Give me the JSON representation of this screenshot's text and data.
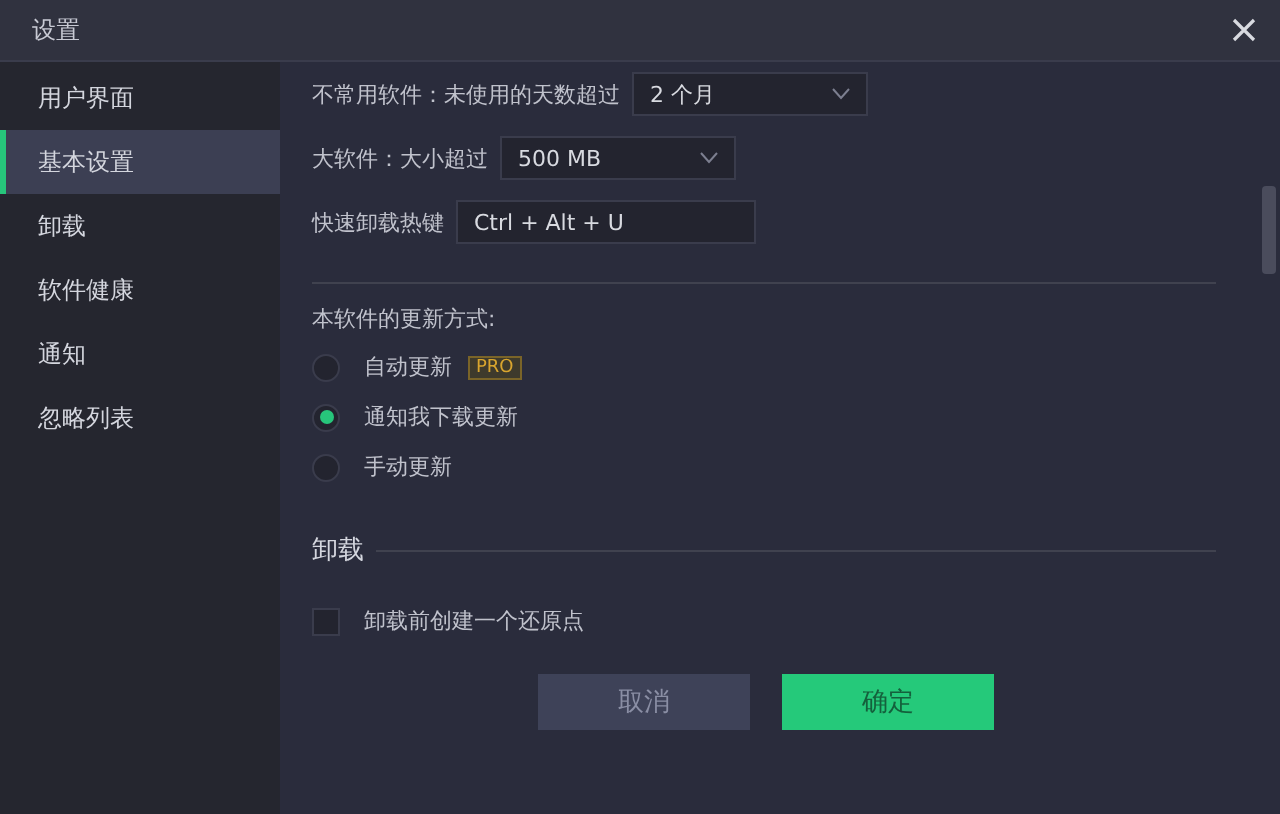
{
  "window": {
    "title": "设置"
  },
  "sidebar": {
    "items": [
      {
        "label": "用户界面",
        "selected": false
      },
      {
        "label": "基本设置",
        "selected": true
      },
      {
        "label": "卸载",
        "selected": false
      },
      {
        "label": "软件健康",
        "selected": false
      },
      {
        "label": "通知",
        "selected": false
      },
      {
        "label": "忽略列表",
        "selected": false
      }
    ]
  },
  "settings": [
    {
      "kind": "dropdown",
      "label": "不常用软件：未使用的天数超过",
      "value": "2 个月"
    },
    {
      "kind": "dropdown",
      "label": "大软件：大小超过",
      "value": "500 MB"
    },
    {
      "kind": "hotkey",
      "label": "快速卸载热键",
      "value": "Ctrl + Alt + U"
    }
  ],
  "update": {
    "label": "本软件的更新方式:",
    "options": [
      {
        "label": "自动更新",
        "badge": "PRO",
        "selected": false
      },
      {
        "label": "通知我下载更新",
        "selected": true
      },
      {
        "label": "手动更新",
        "selected": false
      }
    ]
  },
  "uninstall_section": {
    "title": "卸载",
    "checkbox": {
      "label": "卸载前创建一个还原点",
      "checked": false
    }
  },
  "buttons": [
    {
      "label": "取消",
      "kind": "secondary"
    },
    {
      "label": "确定",
      "kind": "primary"
    }
  ]
}
